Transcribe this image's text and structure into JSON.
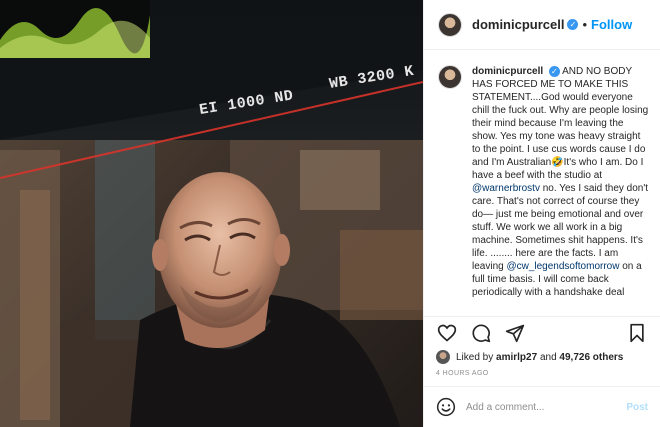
{
  "header": {
    "username": "dominicpurcell",
    "separator": "•",
    "follow_label": "Follow"
  },
  "media_overlay": {
    "exposure_text": "EI 1000 ND",
    "white_balance_text": "WB 3200 K"
  },
  "caption": {
    "username": "dominicpurcell",
    "segments": {
      "a": "AND NO BODY HAS FORCED ME TO MAKE THIS STATEMENT....God would everyone chill the fuck out. Why are people losing their mind because I'm leaving the show. Yes my tone was heavy straight to the point. I use cus words cause I do and I'm Australian",
      "emoji": "🤣",
      "b": "It's who I am. Do I have a beef with the studio at ",
      "mention1": "@warnerbrostv",
      "c": " no. Yes I said they don't care. That's not correct of course they do— just me being emotional and over stuff. We work we all work in a big machine. Sometimes shit happens. It's life. ........ here are the facts. I am leaving ",
      "mention2": "@cw_legendsoftomorrow",
      "d": " on a full time basis. I will come back periodically with a handshake deal"
    }
  },
  "likes": {
    "prefix": "Liked by ",
    "user": "amirlp27",
    "middle": " and ",
    "count": "49,726 others"
  },
  "timestamp": "4 HOURS AGO",
  "comment_box": {
    "placeholder": "Add a comment...",
    "post_label": "Post"
  },
  "colors": {
    "accent": "#0095f6",
    "verified": "#3897f0",
    "post_disabled": "#b2dffc"
  },
  "icons": [
    "verified-badge-icon",
    "heart-icon",
    "comment-icon",
    "share-icon",
    "bookmark-icon",
    "smiley-icon"
  ]
}
